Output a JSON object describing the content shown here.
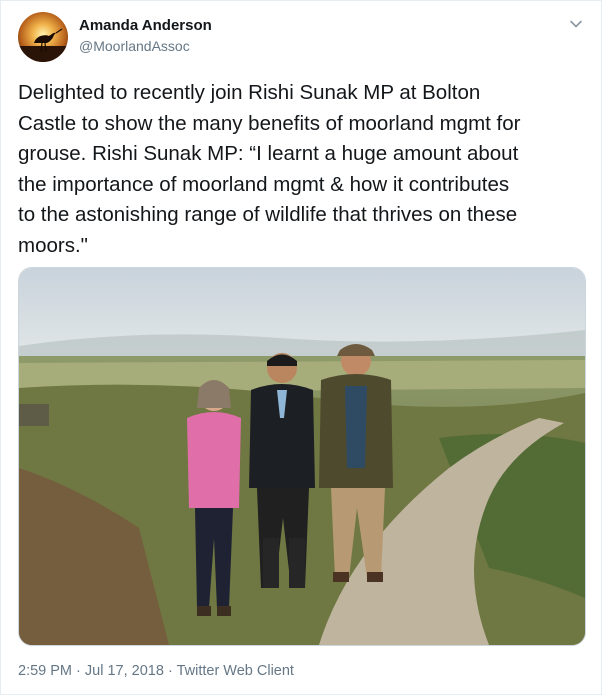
{
  "author": {
    "display_name": "Amanda Anderson",
    "handle": "@MoorlandAssoc"
  },
  "tweet": {
    "text": "Delighted to recently join Rishi Sunak MP at Bolton\nCastle to show the many benefits of moorland mgmt for\ngrouse. Rishi Sunak MP: “I learnt a huge amount about\nthe importance of moorland mgmt & how it contributes\nto the astonishing range of wildlife that thrives on these\nmoors.\"",
    "time": "2:59 PM",
    "separator": "·",
    "date": "Jul 17, 2018",
    "source": "Twitter Web Client"
  },
  "icons": {
    "avatar": "avatar-bird-silhouette",
    "menu": "chevron-down-icon"
  },
  "colors": {
    "primary_text": "#14171a",
    "secondary_text": "#657786",
    "border": "#e6ecf0"
  }
}
